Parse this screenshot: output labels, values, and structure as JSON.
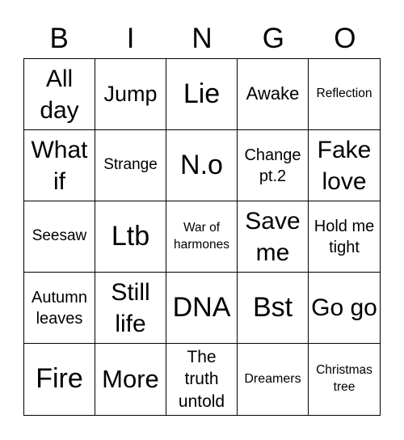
{
  "header": [
    "B",
    "I",
    "N",
    "G",
    "O"
  ],
  "cells": [
    "All day",
    "Jump",
    "Lie",
    "Awake",
    "Reflection",
    "What if",
    "Strange",
    "N.o",
    "Change pt.2",
    "Fake love",
    "Seesaw",
    "Ltb",
    "War of harmones",
    "Save me",
    "Hold me tight",
    "Autumn leaves",
    "Still life",
    "DNA",
    "Bst",
    "Go go",
    "Fire",
    "More",
    "The truth untold",
    "Dreamers",
    "Christmas tree"
  ]
}
